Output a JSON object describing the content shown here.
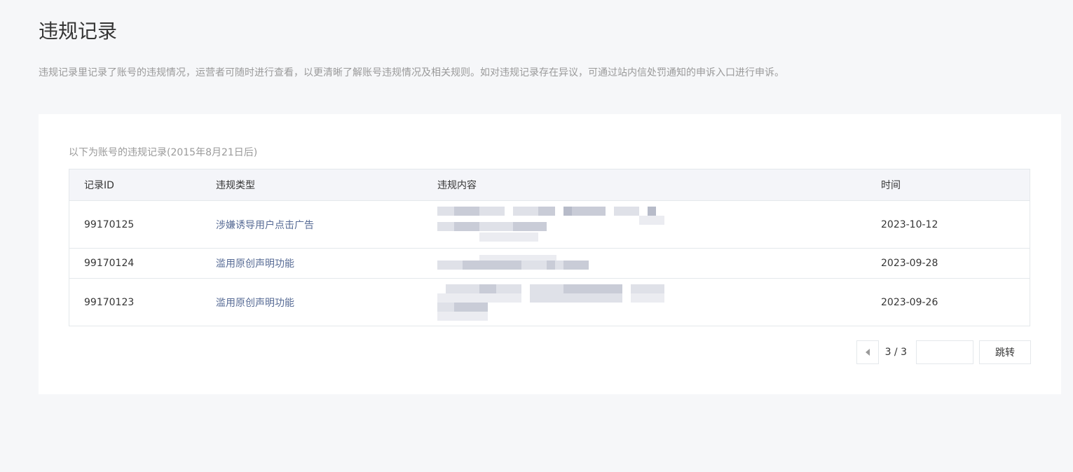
{
  "header": {
    "title": "违规记录",
    "description": "违规记录里记录了账号的违规情况，运营者可随时进行查看，以更清晰了解账号违规情况及相关规则。如对违规记录存在异议，可通过站内信处罚通知的申诉入口进行申诉。"
  },
  "panel": {
    "caption": "以下为账号的违规记录(2015年8月21日后)",
    "table": {
      "columns": [
        "记录ID",
        "违规类型",
        "违规内容",
        "时间"
      ],
      "rows": [
        {
          "id": "99170125",
          "type": "涉嫌诱导用户点击广告",
          "content": "",
          "time": "2023-10-12"
        },
        {
          "id": "99170124",
          "type": "滥用原创声明功能",
          "content": "",
          "time": "2023-09-28"
        },
        {
          "id": "99170123",
          "type": "滥用原创声明功能",
          "content": "",
          "time": "2023-09-26"
        }
      ]
    },
    "pager": {
      "page_text": "3 / 3",
      "input_value": "",
      "go_label": "跳转"
    }
  }
}
